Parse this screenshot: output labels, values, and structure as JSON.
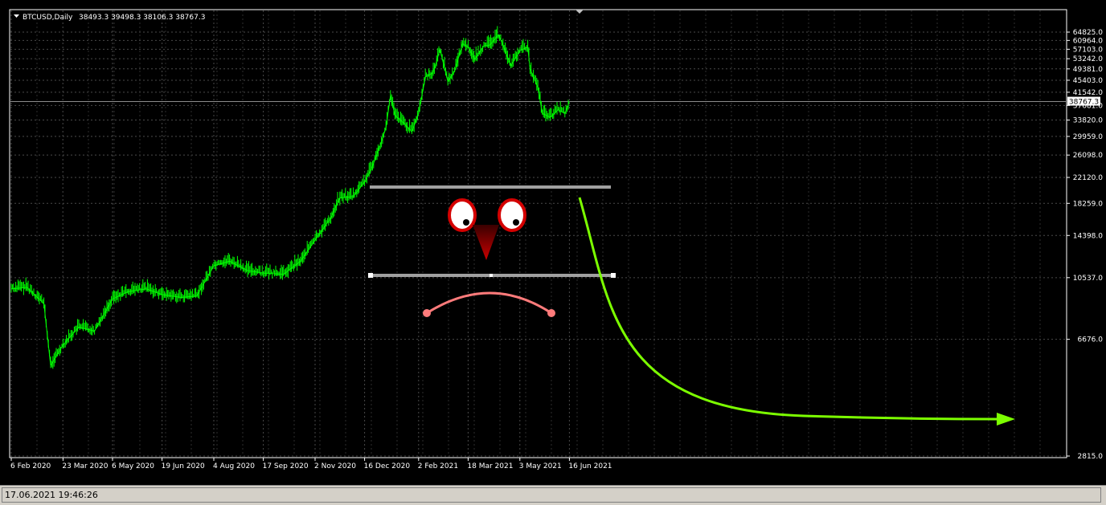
{
  "chart_data": {
    "type": "line",
    "title": "BTCUSD,Daily",
    "ohlc": "38493.3 39498.3 38106.3 38767.3",
    "current_price": "38767.3",
    "ylim": [
      2815.0,
      66500
    ],
    "y_ticks": [
      "64825.0",
      "60964.0",
      "57103.0",
      "53242.0",
      "49381.0",
      "45403.0",
      "41542.0",
      "37681.0",
      "33820.0",
      "29959.0",
      "26098.0",
      "22120.0",
      "18259.0",
      "14398.0",
      "10537.0",
      "6676.0",
      "2815.0"
    ],
    "x_ticks": [
      "6 Feb 2020",
      "23 Mar 2020",
      "6 May 2020",
      "19 Jun 2020",
      "4 Aug 2020",
      "17 Sep 2020",
      "2 Nov 2020",
      "16 Dec 2020",
      "2 Feb 2021",
      "18 Mar 2021",
      "3 May 2021",
      "16 Jun 2021"
    ],
    "series": [
      {
        "x": [
          "2020-02-06",
          "2020-02-20",
          "2020-03-06",
          "2020-03-12",
          "2020-03-23",
          "2020-04-06",
          "2020-04-20",
          "2020-05-06",
          "2020-05-20",
          "2020-06-05",
          "2020-06-19",
          "2020-07-06",
          "2020-07-20",
          "2020-08-04",
          "2020-08-18",
          "2020-09-03",
          "2020-09-17",
          "2020-10-05",
          "2020-10-20",
          "2020-11-02",
          "2020-11-16",
          "2020-11-24",
          "2020-12-06",
          "2020-12-16",
          "2020-12-22",
          "2020-12-29",
          "2021-01-04",
          "2021-01-08",
          "2021-01-12",
          "2021-01-20",
          "2021-01-27",
          "2021-02-02",
          "2021-02-08",
          "2021-02-15",
          "2021-02-21",
          "2021-02-28",
          "2021-03-06",
          "2021-03-13",
          "2021-03-18",
          "2021-03-24",
          "2021-04-01",
          "2021-04-06",
          "2021-04-14",
          "2021-04-18",
          "2021-04-25",
          "2021-05-03",
          "2021-05-10",
          "2021-05-12",
          "2021-05-19",
          "2021-05-23",
          "2021-05-30",
          "2021-06-06",
          "2021-06-12",
          "2021-06-16"
        ],
        "values": [
          9700,
          9800,
          8700,
          5500,
          6400,
          7300,
          7100,
          9000,
          9500,
          9700,
          9300,
          9100,
          9200,
          11500,
          11900,
          11100,
          10900,
          10800,
          11900,
          13900,
          16400,
          19000,
          19200,
          21400,
          23500,
          27500,
          32000,
          40500,
          35000,
          33000,
          31000,
          35500,
          46500,
          48000,
          57000,
          45000,
          48500,
          59500,
          58000,
          53000,
          58500,
          58800,
          63500,
          59000,
          50500,
          56500,
          58000,
          49500,
          43000,
          35500,
          34500,
          36500,
          35500,
          38767
        ]
      }
    ]
  },
  "status": {
    "datetime": "17.06.2021 19:46:26"
  },
  "colors": {
    "background": "#000000",
    "grid": "#4a4a4a",
    "candles": "#00ff00",
    "level_lines": "#a0a0a0",
    "forecast_arrow": "#7cff00",
    "mouth": "#ff7b7b",
    "eye_ring": "#d40000",
    "beak": "#cc0000"
  }
}
